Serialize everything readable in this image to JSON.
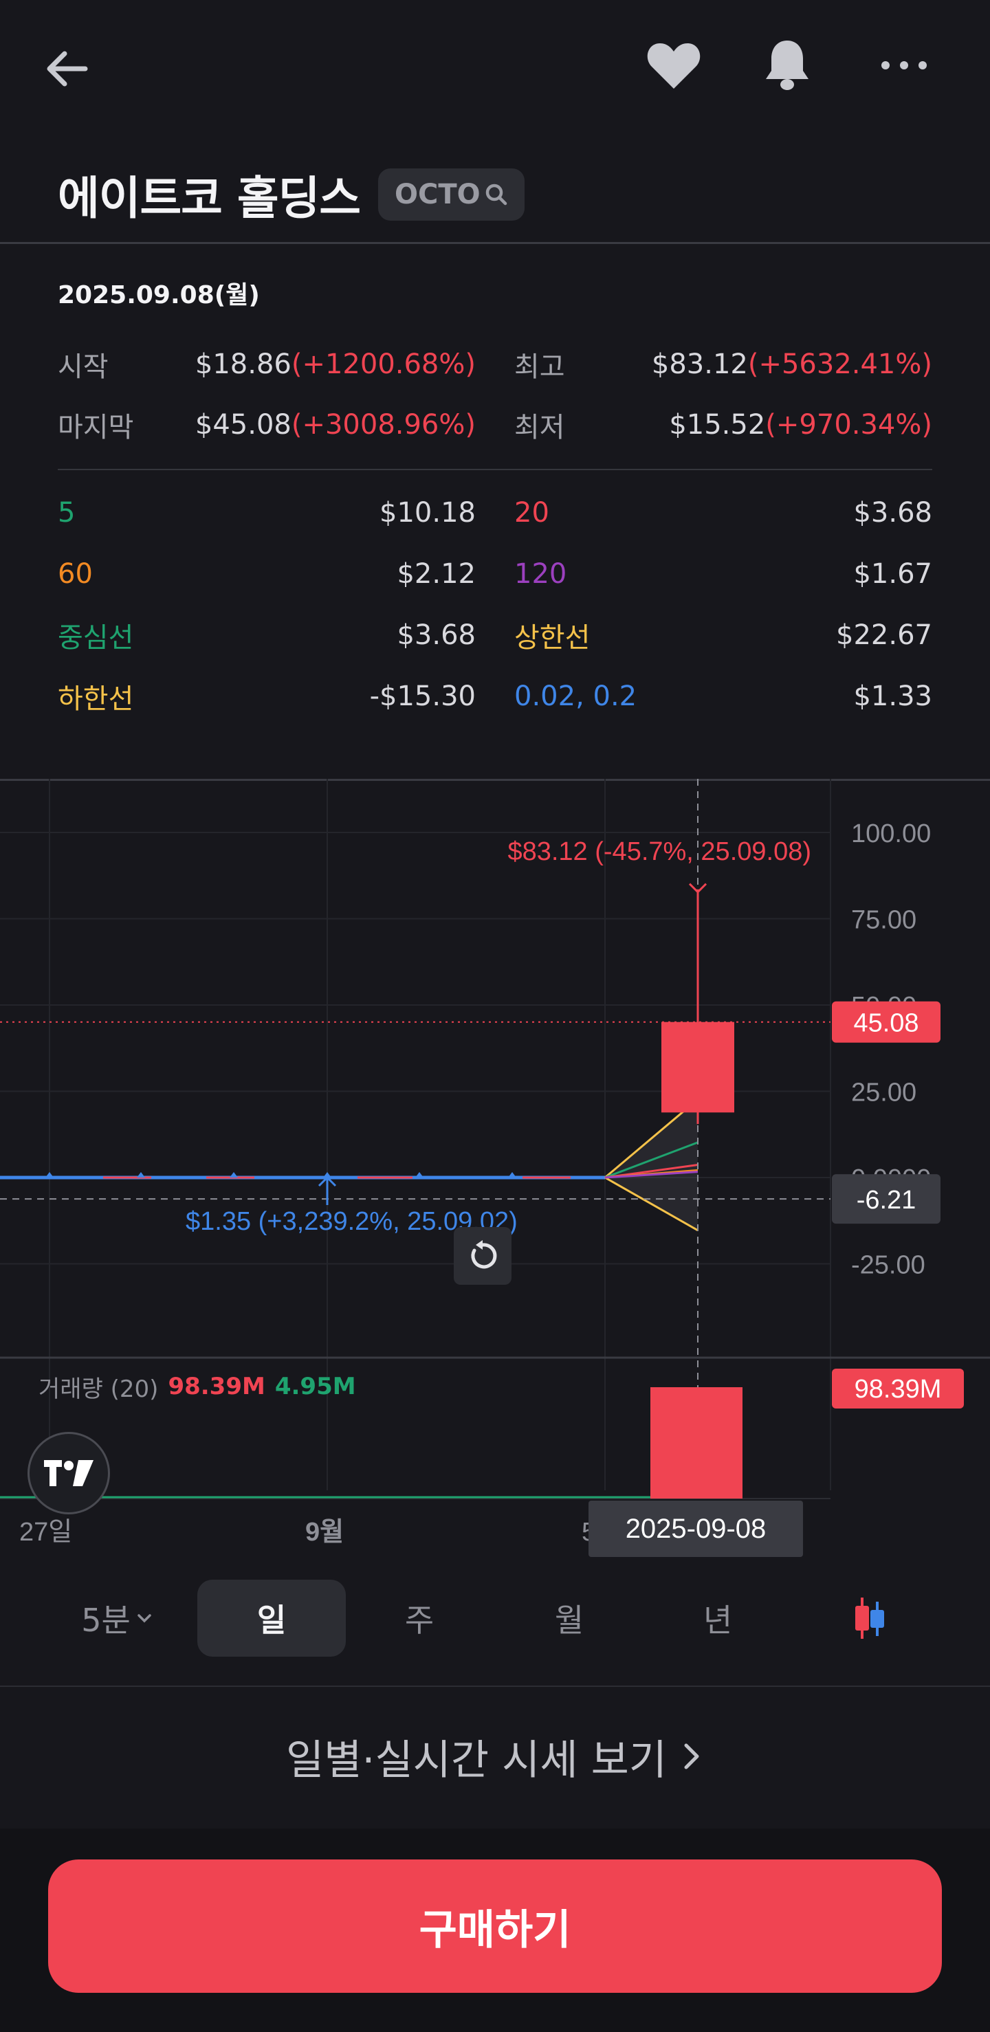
{
  "header": {
    "back_icon": "arrow-left-icon",
    "favorite_icon": "heart-icon",
    "alert_icon": "bell-icon",
    "more_icon": "more-dots-icon"
  },
  "stock": {
    "name": "에이트코 홀딩스",
    "ticker": "OCTO",
    "ticker_icon": "search-icon"
  },
  "info": {
    "date": "2025.09.08(월)",
    "open_label": "시작",
    "open_value": "$18.86",
    "open_change": "(+1200.68%)",
    "high_label": "최고",
    "high_value": "$83.12",
    "high_change": "(+5632.41%)",
    "close_label": "마지막",
    "close_value": "$45.08",
    "close_change": "(+3008.96%)",
    "low_label": "최저",
    "low_value": "$15.52",
    "low_change": "(+970.34%)"
  },
  "indicators": [
    {
      "label": "5",
      "value": "$10.18",
      "color": "#1fa36f"
    },
    {
      "label": "20",
      "value": "$3.68",
      "color": "#f04452"
    },
    {
      "label": "60",
      "value": "$2.12",
      "color": "#f28a23"
    },
    {
      "label": "120",
      "value": "$1.67",
      "color": "#9c40bf"
    },
    {
      "label": "중심선",
      "value": "$3.68",
      "color": "#1fa36f"
    },
    {
      "label": "상한선",
      "value": "$22.67",
      "color": "#f5c24a"
    },
    {
      "label": "하한선",
      "value": "-$15.30",
      "color": "#f5c24a"
    },
    {
      "label": "0.02, 0.2",
      "value": "$1.33",
      "color": "#3f86e8"
    }
  ],
  "chart_data": {
    "type": "candlestick",
    "price_axis_ticks": [
      "100.00",
      "75.00",
      "50.00",
      "25.00",
      "0.0000",
      "-25.00"
    ],
    "price_axis_values": [
      100,
      75,
      50,
      25,
      0,
      -25
    ],
    "ylim": [
      -35,
      110
    ],
    "x_tick_labels": [
      "27일",
      "9월",
      "5"
    ],
    "current_price_label": "45.08",
    "crosshair_price_label": "-6.21",
    "crosshair_date_label": "2025-09-08",
    "high_annotation": "$83.12 (-45.7%, 25.09.08)",
    "low_annotation": "$1.35 (+3,239.2%, 25.09.02)",
    "candle": {
      "date": "2025-09-08",
      "open": 18.86,
      "high": 83.12,
      "low": 15.52,
      "close": 45.08
    },
    "volume_label": "거래량 (20)",
    "volume_value": "98.39M",
    "volume_ma": "4.95M",
    "volume_axis_label": "98.39M",
    "reset_icon": "refresh-icon",
    "logo_icon": "tradingview-logo-icon",
    "up_color": "#f04452",
    "down_color": "#3f86e8"
  },
  "tabs": {
    "interval": "5분",
    "day": "일",
    "week": "주",
    "month": "월",
    "year": "년",
    "chart_style_icon": "candle-style-icon"
  },
  "daily_link": "일별·실시간 시세 보기",
  "buy_button": "구매하기"
}
